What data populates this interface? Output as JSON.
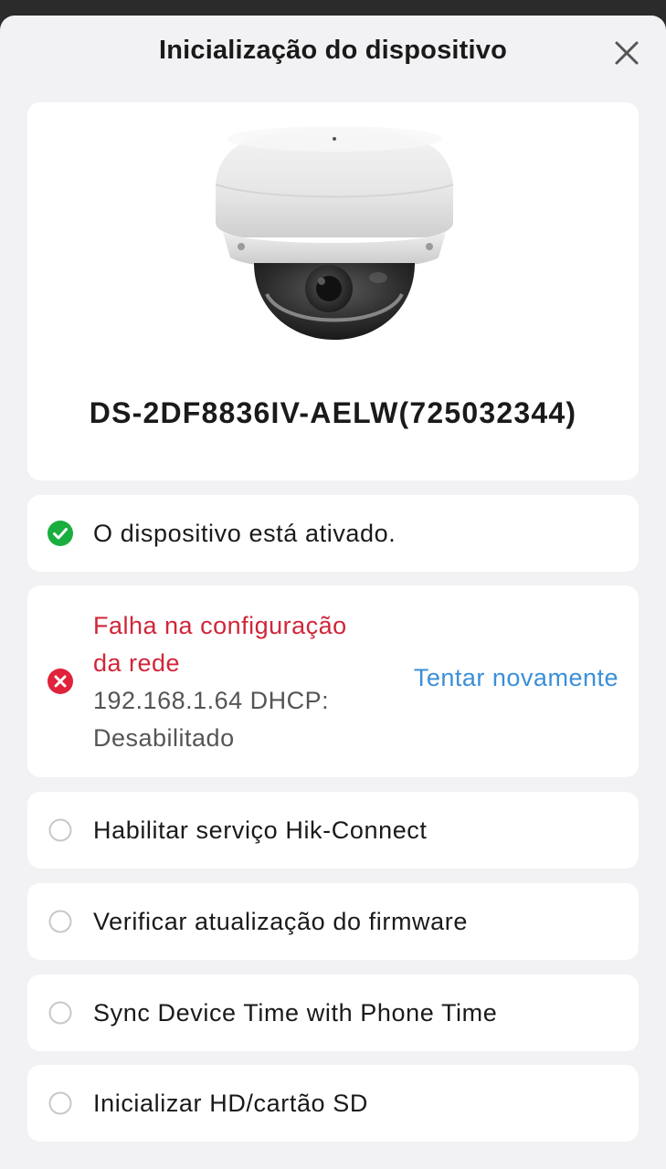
{
  "dialog": {
    "title": "Inicialização do dispositivo"
  },
  "device": {
    "model": "DS-2DF8836IV-AELW(725032344)"
  },
  "steps": [
    {
      "label": "O dispositivo está ativado.",
      "status": "success"
    },
    {
      "label": "Falha na configuração da rede",
      "detail": "192.168.1.64  DHCP: Desabilitado",
      "status": "error",
      "action": "Tentar novamente"
    },
    {
      "label": "Habilitar serviço Hik-Connect",
      "status": "pending"
    },
    {
      "label": "Verificar atualização do firmware",
      "status": "pending"
    },
    {
      "label": "Sync Device Time with Phone Time",
      "status": "pending"
    },
    {
      "label": "Inicializar HD/cartão SD",
      "status": "pending"
    }
  ],
  "colors": {
    "success": "#1aae3f",
    "error": "#e0223a",
    "link": "#3a8fd9",
    "pending": "#c8c8cc"
  },
  "icons": {
    "close": "close-icon",
    "success": "check-circle-icon",
    "error": "error-circle-icon",
    "pending": "empty-circle-icon"
  }
}
